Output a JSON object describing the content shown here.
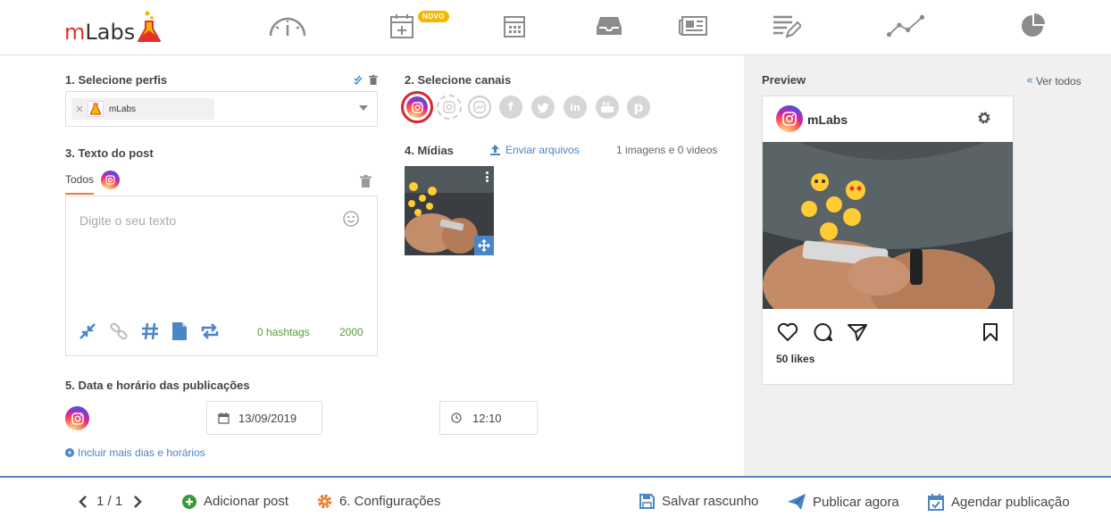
{
  "brand": {
    "name_m": "m",
    "name_rest": "Labs"
  },
  "nav": {
    "items": [
      "dashboard-gauge-icon",
      "calendar-plus-icon",
      "calendar-icon",
      "inbox-icon",
      "newspaper-icon",
      "report-edit-icon",
      "line-chart-icon",
      "pie-chart-icon"
    ],
    "new_badge": "NOVO"
  },
  "profiles": {
    "title": "1. Selecione perfis",
    "selected": "mLabs"
  },
  "channels": {
    "title": "2. Selecione canais",
    "icons": [
      "instagram-icon",
      "instagram-story-icon",
      "instagram-message-icon",
      "facebook-icon",
      "twitter-icon",
      "linkedin-icon",
      "youtube-icon",
      "pinterest-icon"
    ]
  },
  "post_text": {
    "title": "3. Texto do post",
    "tab_all": "Todos",
    "placeholder": "Digite o seu texto",
    "hashtags": "0 hashtags",
    "char_count": "2000"
  },
  "media": {
    "title": "4. Mídias",
    "upload_label": "Enviar arquivos",
    "count_label": "1 imagens e 0 videos"
  },
  "schedule": {
    "title": "5. Data e horário das publicações",
    "date": "13/09/2019",
    "time": "12:10",
    "add_more": "Incluir mais dias e horários"
  },
  "preview": {
    "title": "Preview",
    "see_all": "Ver todos",
    "account": "mLabs",
    "likes": "50 likes"
  },
  "footer": {
    "pager": "1 / 1",
    "add_post": "Adicionar post",
    "settings": "6. Configurações",
    "save_draft": "Salvar rascunho",
    "publish_now": "Publicar agora",
    "schedule_post": "Agendar publicação"
  },
  "colors": {
    "accent_blue": "#4a86c5",
    "brand_red": "#e3322c",
    "tab_orange": "#f07c2e",
    "count_green": "#5a9a3a",
    "badge_yellow": "#f5b800"
  }
}
